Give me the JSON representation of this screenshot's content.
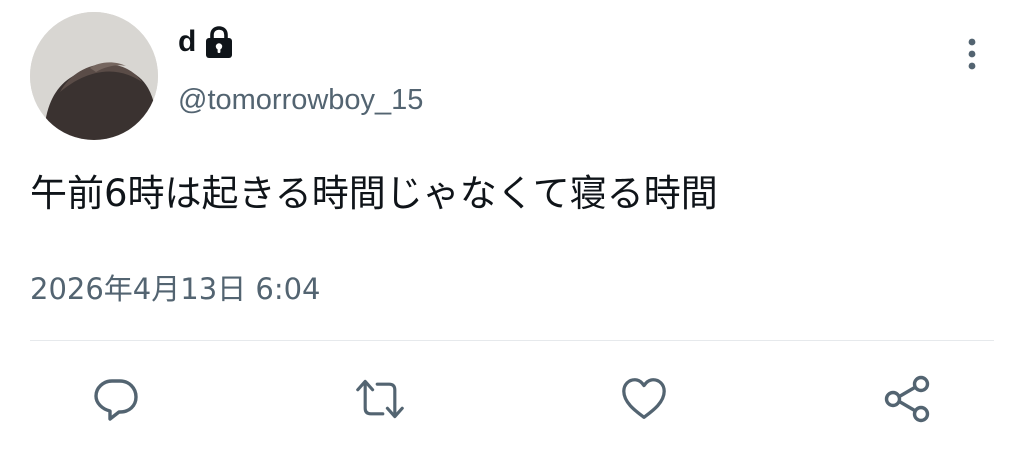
{
  "user": {
    "display_name": "d",
    "handle": "@tomorrowboy_15",
    "protected_icon": "lock-icon",
    "avatar": "avatar-photo"
  },
  "tweet": {
    "text": "午前6時は起きる時間じゃなくて寝る時間",
    "timestamp": "2026年4月13日 6:04"
  },
  "actions": {
    "reply_icon": "reply-icon",
    "retweet_icon": "retweet-icon",
    "like_icon": "like-icon",
    "share_icon": "share-icon",
    "more_icon": "more-options-icon"
  },
  "colors": {
    "text_primary": "#0f1419",
    "text_secondary": "#536471",
    "icon": "#536471",
    "divider": "#e6e9ec"
  }
}
